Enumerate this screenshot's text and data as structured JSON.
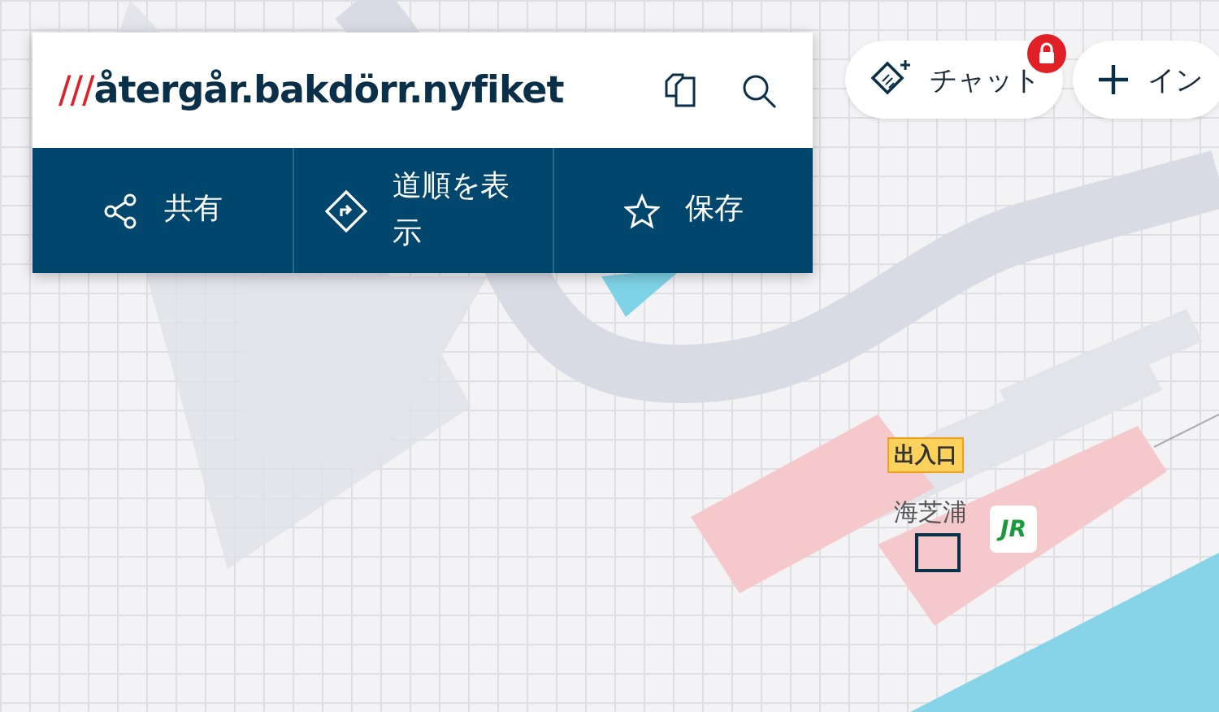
{
  "address": {
    "prefix": "///",
    "words": "återgår.bakdörr.nyfiket"
  },
  "actions": [
    {
      "kind": "share",
      "label": "共有"
    },
    {
      "kind": "directions",
      "label": "道順を表示"
    },
    {
      "kind": "save",
      "label": "保存"
    }
  ],
  "top_buttons": [
    {
      "kind": "chat",
      "label": "チャット"
    },
    {
      "kind": "add",
      "label": "イン"
    }
  ],
  "map_labels": {
    "entrance": "出入口",
    "station": "海芝浦",
    "station_logo": "JR"
  }
}
